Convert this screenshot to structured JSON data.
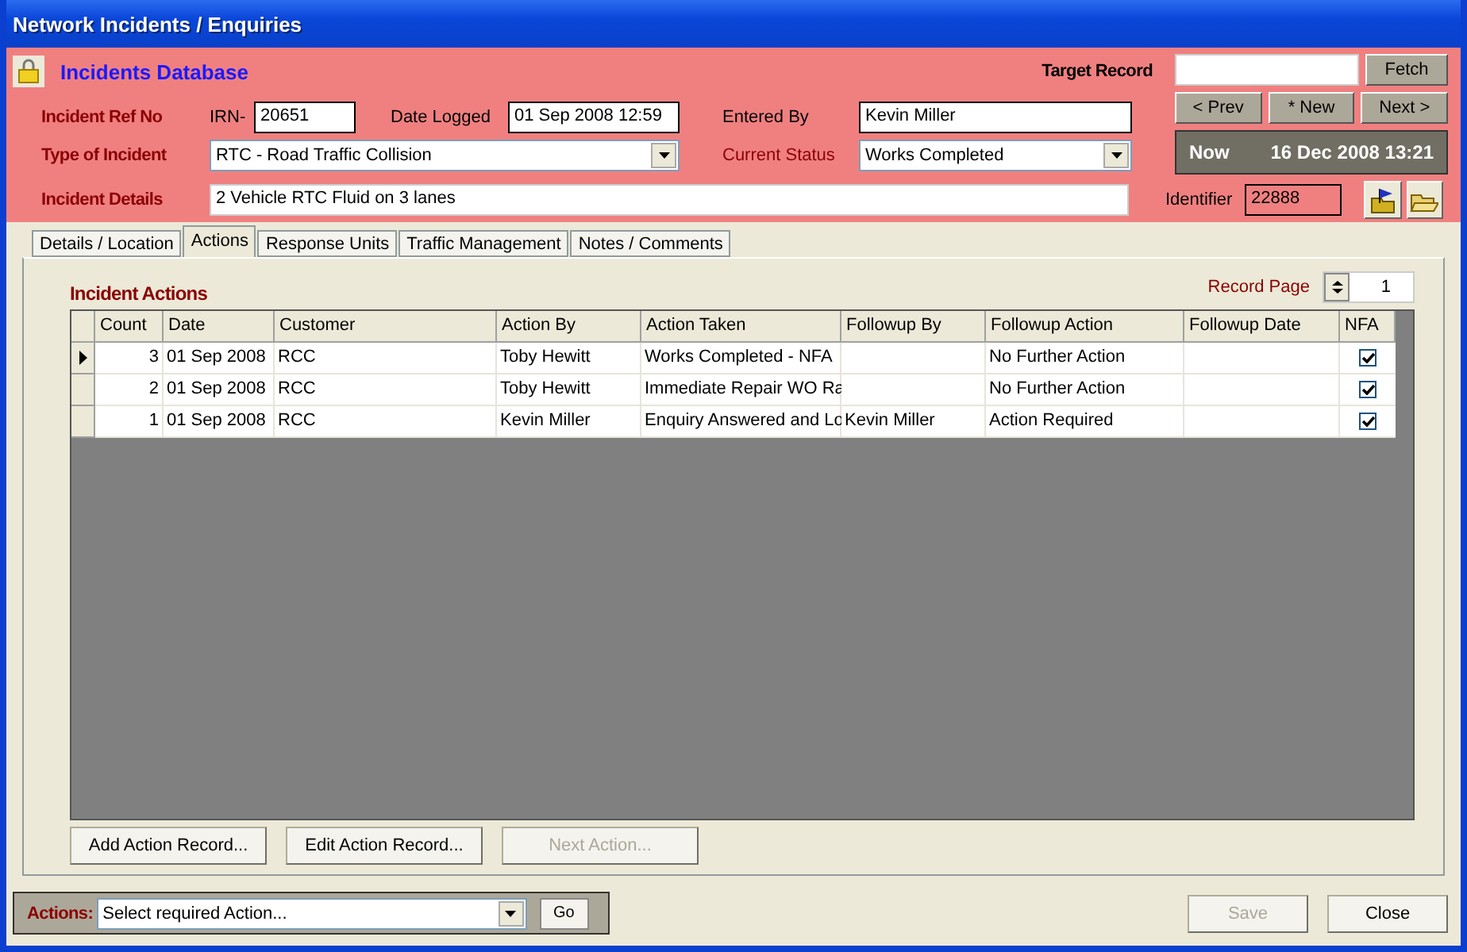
{
  "window": {
    "title": "Network Incidents / Enquiries"
  },
  "header": {
    "title": "Incidents Database",
    "target_record": {
      "label": "Target Record",
      "button": "Fetch"
    },
    "ref": {
      "label": "Incident Ref No",
      "prefix": "IRN-",
      "value": "20651"
    },
    "date_logged": {
      "label": "Date Logged",
      "value": "01 Sep 2008 12:59"
    },
    "entered_by": {
      "label": "Entered By",
      "value": "Kevin Miller"
    },
    "type": {
      "label": "Type of Incident",
      "value": "RTC - Road Traffic Collision"
    },
    "status": {
      "label": "Current Status",
      "value": "Works Completed"
    },
    "details": {
      "label": "Incident Details",
      "value": "2 Vehicle RTC Fluid on 3 lanes"
    },
    "nav": [
      "< Prev",
      "* New",
      "Next >"
    ],
    "now": {
      "label": "Now",
      "value": "16 Dec 2008 13:21"
    },
    "identifier": {
      "label": "Identifier",
      "value": "22888"
    }
  },
  "tabs": [
    {
      "label": "Details / Location",
      "selected": false
    },
    {
      "label": "Actions",
      "selected": true
    },
    {
      "label": "Response Units",
      "selected": false
    },
    {
      "label": "Traffic Management",
      "selected": false
    },
    {
      "label": "Notes / Comments",
      "selected": false
    }
  ],
  "section_title": "Incident Actions",
  "record_page": {
    "label": "Record Page",
    "value": "1"
  },
  "table": {
    "columns": [
      "Count",
      "Date",
      "Customer",
      "Action By",
      "Action Taken",
      "Followup By",
      "Followup Action",
      "Followup Date",
      "NFA"
    ],
    "rows": [
      {
        "selected": true,
        "cells": [
          "3",
          "01 Sep 2008",
          "RCC",
          "Toby Hewitt",
          "Works Completed - NFA",
          "",
          "No Further Action",
          ""
        ],
        "nfa": true
      },
      {
        "selected": false,
        "cells": [
          "2",
          "01 Sep 2008",
          "RCC",
          "Toby Hewitt",
          "Immediate Repair WO Ra",
          "",
          "No Further Action",
          ""
        ],
        "nfa": true
      },
      {
        "selected": false,
        "cells": [
          "1",
          "01 Sep 2008",
          "RCC",
          "Kevin Miller",
          "Enquiry Answered and Lo",
          "Kevin Miller",
          "Action Required",
          ""
        ],
        "nfa": true
      }
    ]
  },
  "tab_buttons": [
    {
      "label": "Add Action Record...",
      "disabled": false
    },
    {
      "label": "Edit Action Record...",
      "disabled": false
    },
    {
      "label": "Next Action...",
      "disabled": true
    }
  ],
  "actions_bar": {
    "label": "Actions:",
    "value": "Select required Action...",
    "button": "Go"
  },
  "footer_buttons": [
    {
      "label": "Save",
      "disabled": true
    },
    {
      "label": "Close",
      "disabled": false
    }
  ]
}
